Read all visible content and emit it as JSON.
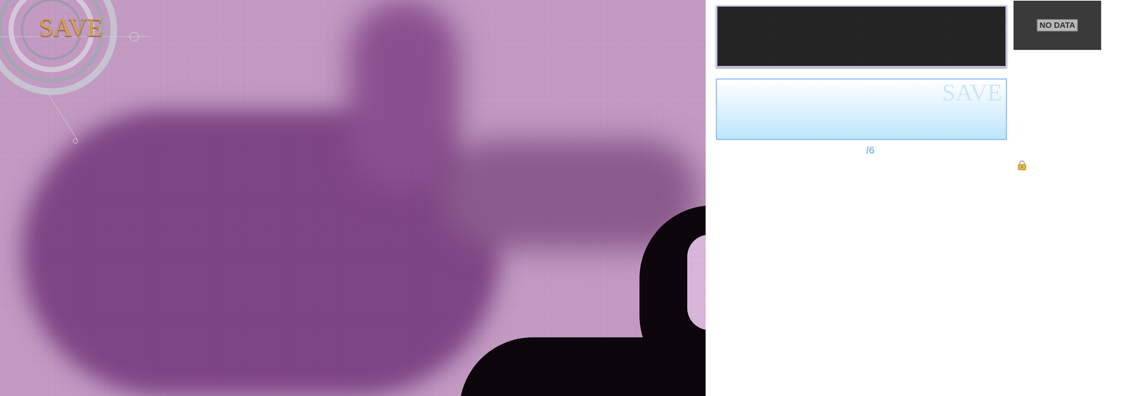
{
  "title_logo": "SAVE",
  "save_slot": {
    "thumbnail_label": "NO DATA",
    "watermark": "SAVE",
    "page_counter": "/6",
    "locked": true
  }
}
